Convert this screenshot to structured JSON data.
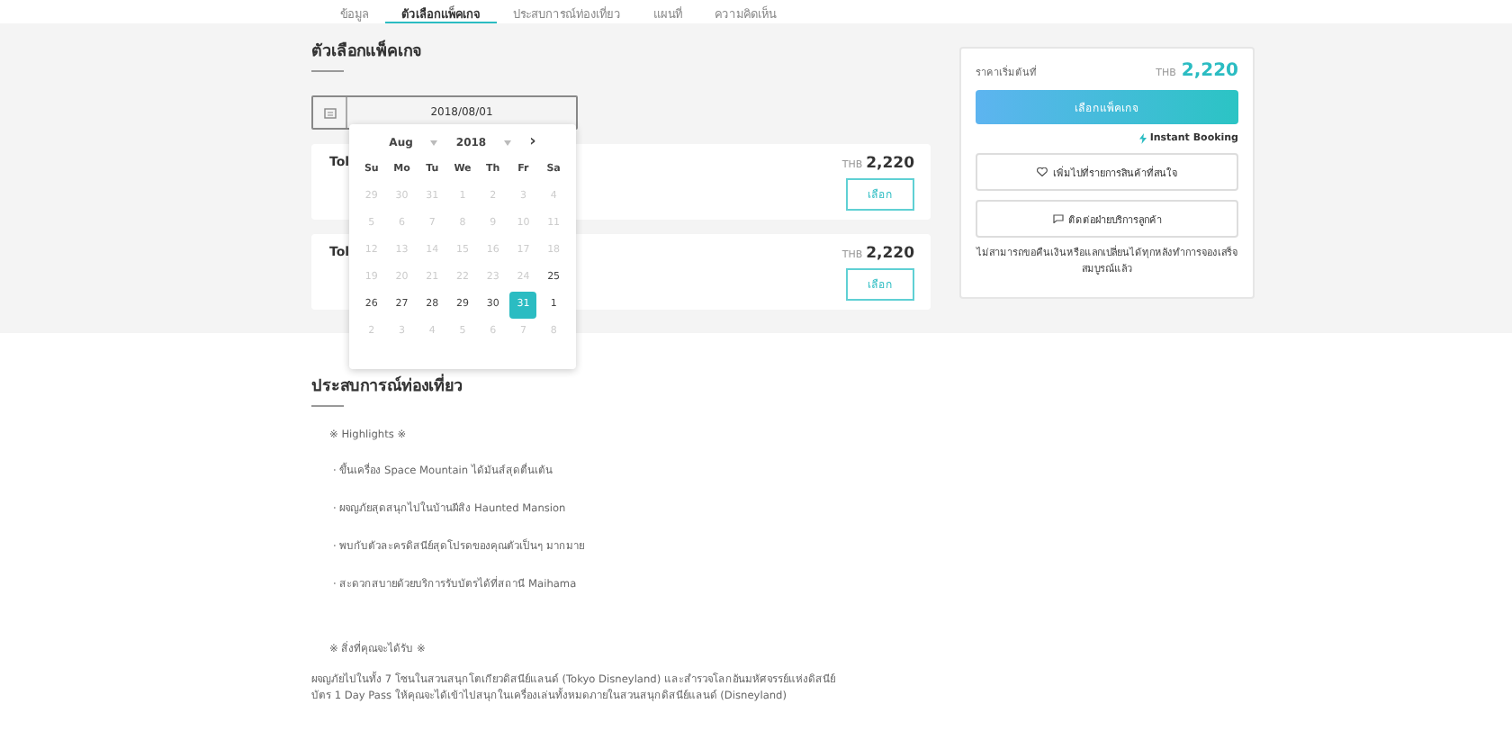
{
  "tabs": [
    {
      "label": "ข้อมูล",
      "selected": false
    },
    {
      "label": "ตัวเลือกแพ็คเกจ",
      "selected": true
    },
    {
      "label": "ประสบการณ์ท่องเที่ยว",
      "selected": false
    },
    {
      "label": "แผนที่",
      "selected": false
    },
    {
      "label": "ความคิดเห็น",
      "selected": false
    }
  ],
  "packages": {
    "title": "ตัวเลือกแพ็คเกจ",
    "date_field": {
      "value": "2018/08/01"
    },
    "cards": [
      {
        "name": "Tol",
        "currency": "THB",
        "price": "2,220",
        "button": "เลือก"
      },
      {
        "name": "Tol",
        "currency": "THB",
        "price": "2,220",
        "button": "เลือก"
      }
    ],
    "calendar": {
      "month": "Aug",
      "year": "2018",
      "next": "›",
      "weekdays": [
        "Su",
        "Mo",
        "Tu",
        "We",
        "Th",
        "Fr",
        "Sa"
      ],
      "days": [
        {
          "label": "29",
          "muted": true,
          "selected": false
        },
        {
          "label": "30",
          "muted": true,
          "selected": false
        },
        {
          "label": "31",
          "muted": true,
          "selected": false
        },
        {
          "label": "1",
          "muted": true,
          "selected": false
        },
        {
          "label": "2",
          "muted": true,
          "selected": false
        },
        {
          "label": "3",
          "muted": true,
          "selected": false
        },
        {
          "label": "4",
          "muted": true,
          "selected": false
        },
        {
          "label": "5",
          "muted": true,
          "selected": false
        },
        {
          "label": "6",
          "muted": true,
          "selected": false
        },
        {
          "label": "7",
          "muted": true,
          "selected": false
        },
        {
          "label": "8",
          "muted": true,
          "selected": false
        },
        {
          "label": "9",
          "muted": true,
          "selected": false
        },
        {
          "label": "10",
          "muted": true,
          "selected": false
        },
        {
          "label": "11",
          "muted": true,
          "selected": false
        },
        {
          "label": "12",
          "muted": true,
          "selected": false
        },
        {
          "label": "13",
          "muted": true,
          "selected": false
        },
        {
          "label": "14",
          "muted": true,
          "selected": false
        },
        {
          "label": "15",
          "muted": true,
          "selected": false
        },
        {
          "label": "16",
          "muted": true,
          "selected": false
        },
        {
          "label": "17",
          "muted": true,
          "selected": false
        },
        {
          "label": "18",
          "muted": true,
          "selected": false
        },
        {
          "label": "19",
          "muted": true,
          "selected": false
        },
        {
          "label": "20",
          "muted": true,
          "selected": false
        },
        {
          "label": "21",
          "muted": true,
          "selected": false
        },
        {
          "label": "22",
          "muted": true,
          "selected": false
        },
        {
          "label": "23",
          "muted": true,
          "selected": false
        },
        {
          "label": "24",
          "muted": true,
          "selected": false
        },
        {
          "label": "25",
          "muted": false,
          "selected": false
        },
        {
          "label": "26",
          "muted": false,
          "selected": false
        },
        {
          "label": "27",
          "muted": false,
          "selected": false
        },
        {
          "label": "28",
          "muted": false,
          "selected": false
        },
        {
          "label": "29",
          "muted": false,
          "selected": false
        },
        {
          "label": "30",
          "muted": false,
          "selected": false
        },
        {
          "label": "31",
          "muted": false,
          "selected": true
        },
        {
          "label": "1",
          "muted": false,
          "selected": false
        },
        {
          "label": "2",
          "muted": true,
          "selected": false
        },
        {
          "label": "3",
          "muted": true,
          "selected": false
        },
        {
          "label": "4",
          "muted": true,
          "selected": false
        },
        {
          "label": "5",
          "muted": true,
          "selected": false
        },
        {
          "label": "6",
          "muted": true,
          "selected": false
        },
        {
          "label": "7",
          "muted": true,
          "selected": false
        },
        {
          "label": "8",
          "muted": true,
          "selected": false
        }
      ]
    }
  },
  "booking": {
    "price_label": "ราคาเริ่มต้นที่",
    "currency": "THB",
    "price": "2,220",
    "primary_button": "เลือกแพ็คเกจ",
    "instant": "Instant Booking",
    "wishlist_button": "เพิ่มไปที่รายการสินค้าที่สนใจ",
    "contact_button": "ติดต่อฝ่ายบริการลูกค้า",
    "note": "ไม่สามารถขอคืนเงินหรือแลกเปลี่ยนได้ทุกหลังทำการจองเสร็จสมบูรณ์แล้ว"
  },
  "experience": {
    "title": "ประสบการณ์ท่องเที่ยว",
    "highlights_heading": "※ Highlights ※",
    "highlights": [
      "· ขึ้นเครื่อง Space Mountain ได้มันส์สุดตื่นเต้น",
      "· ผจญภัยสุดสนุกไปในบ้านผีสิง Haunted Mansion",
      "· พบกับตัวละครดิสนีย์สุดโปรดของคุณตัวเป็นๆ มากมาย",
      "· สะดวกสบายด้วยบริการรับบัตรได้ที่สถานี Maihama"
    ],
    "includes_heading": "※ สิ่งที่คุณจะได้รับ ※",
    "paragraph": [
      "ผจญภัยไปในทั้ง 7 โซนในสวนสนุกโตเกียวดิสนีย์แลนด์ (Tokyo Disneyland) และสำรวจโลกอันมหัศจรรย์แห่งดิสนีย์",
      "บัตร 1 Day Pass ให้คุณจะได้เข้าไปสนุกในเครื่องเล่นทั้งหมดภายในสวนสนุกดิสนีย์แลนด์ (Disneyland)"
    ]
  }
}
